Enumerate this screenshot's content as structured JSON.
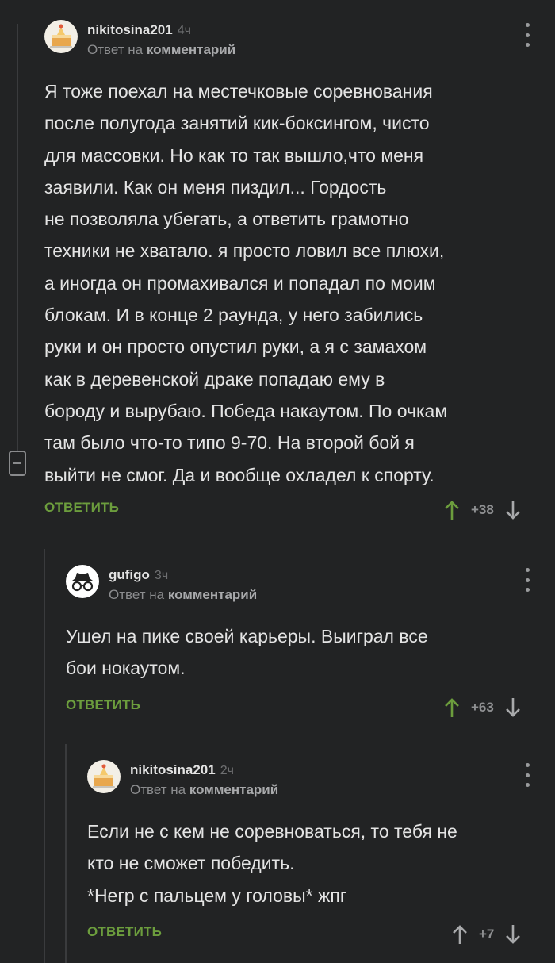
{
  "comments": [
    {
      "username": "nikitosina201",
      "time": "4ч",
      "reply_prefix": "Ответ на",
      "reply_target": "комментарий",
      "avatar_icon": "cake-avatar",
      "text": "Я тоже поехал на местечковые соревнования\nпосле полугода занятий кик-боксингом, чисто\nдля массовки. Но как то так вышло,что меня\nзаявили. Как он меня пиздил... Гордость\nне позволяла убегать, а ответить грамотно\nтехники не хватало.  я просто ловил все плюхи,\nа иногда он промахивался и попадал по моим\nблокам. И в конце 2 раунда, у него забились\nруки и он просто опустил руки, а я с замахом\nкак  в деревенской драке попадаю ему в\nбороду и вырубаю. Победа накаутом. По очкам\nтам было что-то типо 9-70. На второй бой я\nвыйти не смог. Да и вообще охладел к спорту.",
      "reply_label": "ОТВЕТИТЬ",
      "rating": "+38",
      "upvoted": true
    },
    {
      "username": "gufigo",
      "time": "3ч",
      "reply_prefix": "Ответ на",
      "reply_target": "комментарий",
      "avatar_icon": "spy-avatar",
      "text": "Ушел на пике своей карьеры. Выиграл все\nбои нокаутом.",
      "reply_label": "ОТВЕТИТЬ",
      "rating": "+63",
      "upvoted": true
    },
    {
      "username": "nikitosina201",
      "time": "2ч",
      "reply_prefix": "Ответ на",
      "reply_target": "комментарий",
      "avatar_icon": "cake-avatar",
      "text": "Если не с кем не соревноваться, то тебя не\nкто не сможет победить.\n*Негр с пальцем у головы* жпг",
      "reply_label": "ОТВЕТИТЬ",
      "rating": "+7",
      "upvoted": false
    }
  ],
  "colors": {
    "background": "#222324",
    "reply_green": "#6c9d3d",
    "upvote_green": "#6c9d3d",
    "neutral_arrow": "#a8a9ab"
  }
}
